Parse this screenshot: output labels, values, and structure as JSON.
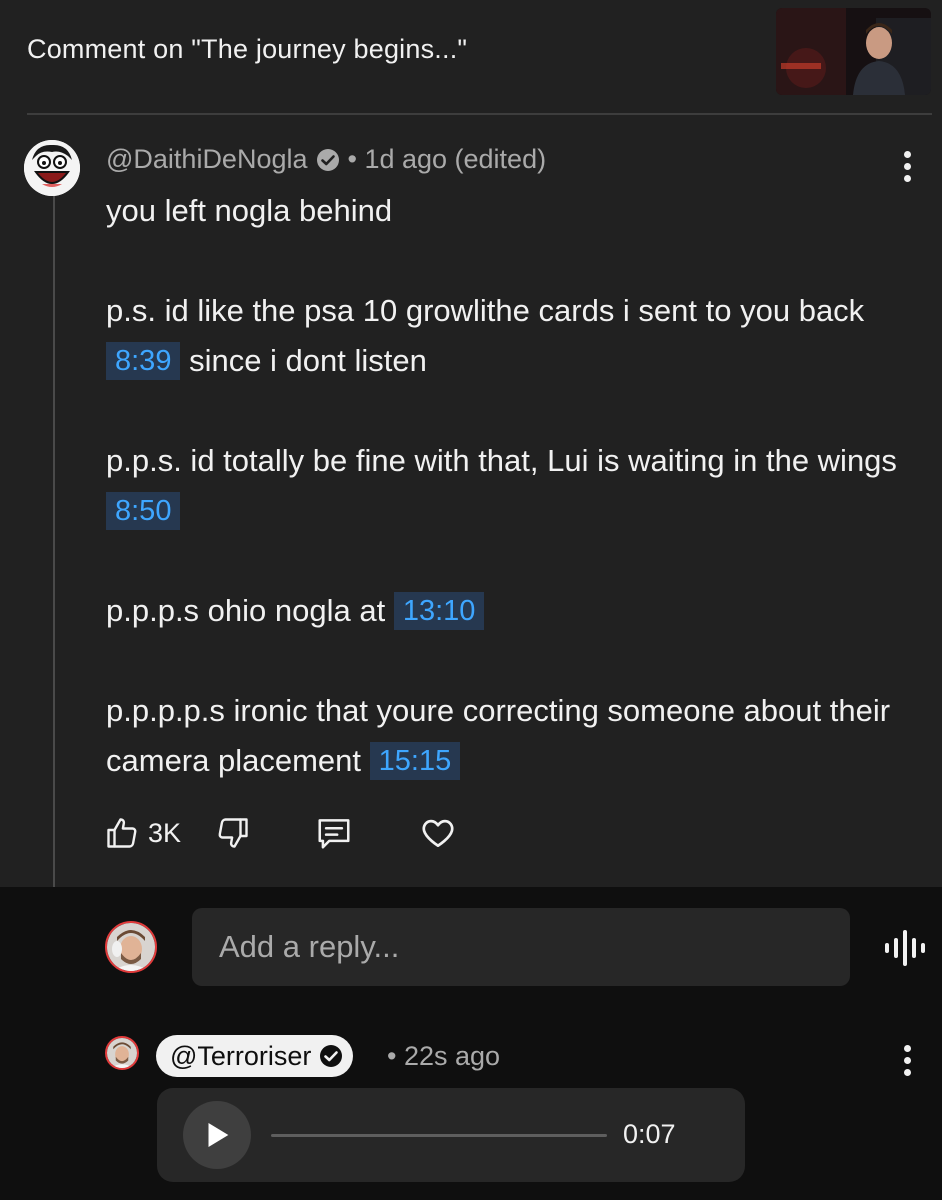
{
  "header": {
    "title": "Comment on \"The journey begins...\""
  },
  "comment": {
    "author": "@DaithiDeNogla",
    "meta_suffix": "• 1d ago (edited)",
    "body": [
      {
        "segments": [
          {
            "text": "you left nogla behind"
          }
        ]
      },
      {
        "segments": [
          {
            "text": "p.s. id like the psa 10 growlithe cards i sent to you back "
          },
          {
            "ts": "8:39"
          },
          {
            "text": " since i dont listen"
          }
        ]
      },
      {
        "segments": [
          {
            "text": "p.p.s. id totally be fine with that, Lui is waiting in the wings  "
          },
          {
            "ts": "8:50"
          }
        ]
      },
      {
        "segments": [
          {
            "text": "p.p.p.s ohio nogla at "
          },
          {
            "ts": "13:10"
          }
        ]
      },
      {
        "segments": [
          {
            "text": "p.p.p.p.s ironic that youre correcting someone about their camera placement "
          },
          {
            "ts": "15:15"
          }
        ]
      }
    ],
    "like_count": "3K"
  },
  "reply_box": {
    "placeholder": "Add a reply..."
  },
  "reply": {
    "author": "@Terroriser",
    "time": "• 22s ago",
    "audio": {
      "duration": "0:07",
      "progress": 0
    }
  },
  "colors": {
    "background": "#212121",
    "reply_band": "#0f0f0f",
    "timestamp_link": "#3ea6ff",
    "timestamp_bg": "#263850"
  },
  "icons": [
    "verified-check-icon",
    "more-vert-icon",
    "thumb-up-icon",
    "thumb-down-icon",
    "comment-icon",
    "heart-icon",
    "voice-input-icon",
    "play-icon"
  ]
}
